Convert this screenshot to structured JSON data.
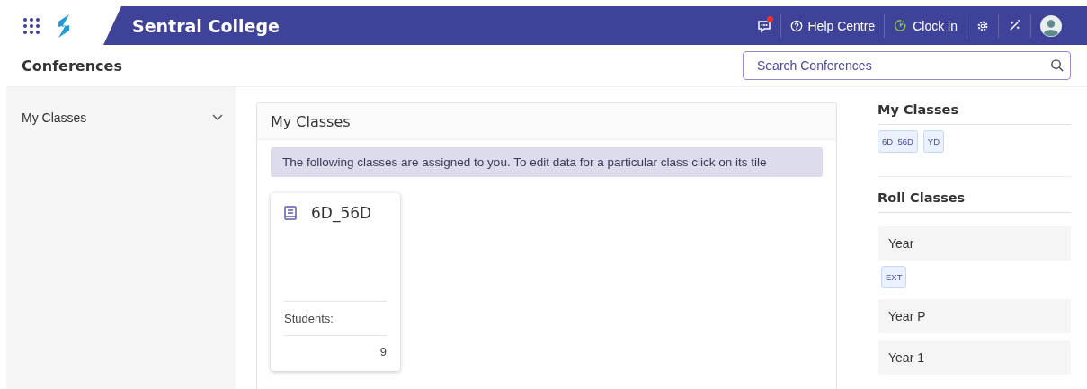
{
  "header": {
    "brand": "Sentral College",
    "messages": {
      "unread": true
    },
    "help": "Help Centre",
    "clock": "Clock in"
  },
  "page": {
    "title": "Conferences",
    "search": {
      "placeholder": "Search Conferences"
    }
  },
  "sidebar": {
    "items": [
      {
        "label": "My Classes",
        "expanded": false
      }
    ]
  },
  "main": {
    "title": "My Classes",
    "notice": "The following classes are assigned to you. To edit data for a particular class click on its tile",
    "tiles": [
      {
        "name": "6D_56D",
        "students_label": "Students:",
        "students": "9"
      }
    ]
  },
  "right": {
    "sections": [
      {
        "kind": "tags",
        "title": "My Classes",
        "tags": [
          "6D_56D",
          "YD"
        ]
      },
      {
        "kind": "groups",
        "title": "Roll Classes",
        "groups": [
          {
            "label": "Year",
            "tags": [
              "EXT"
            ]
          },
          {
            "label": "Year P"
          },
          {
            "label": "Year 1"
          }
        ]
      }
    ]
  }
}
